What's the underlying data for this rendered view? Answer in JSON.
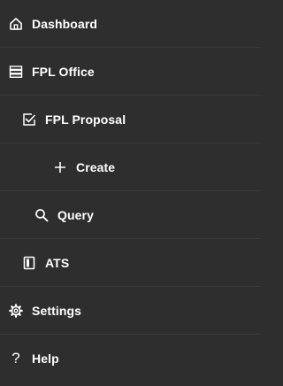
{
  "sidebar": {
    "items": [
      {
        "label": "Dashboard",
        "icon": "home-icon"
      },
      {
        "label": "FPL Office",
        "icon": "server-icon"
      },
      {
        "label": "FPL Proposal",
        "icon": "checkbox-icon"
      },
      {
        "label": "Create",
        "icon": "plus-icon"
      },
      {
        "label": "Query",
        "icon": "search-icon"
      },
      {
        "label": "ATS",
        "icon": "book-icon"
      },
      {
        "label": "Settings",
        "icon": "gear-icon"
      },
      {
        "label": "Help",
        "icon": "question-icon"
      }
    ]
  },
  "colors": {
    "background": "#2e2e2e",
    "divider": "#3b3b3b",
    "text": "#ffffff"
  }
}
